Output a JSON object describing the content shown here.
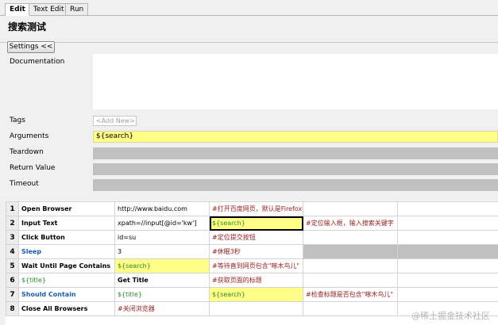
{
  "tabs": [
    "Edit",
    "Text Edit",
    "Run"
  ],
  "title": "搜索测试",
  "settings_label": "Settings <<",
  "fields": {
    "documentation": "Documentation",
    "tags": "Tags",
    "add_new": "<Add New>",
    "arguments": "Arguments",
    "arguments_value": "${search}",
    "teardown": "Teardown",
    "return_value": "Return Value",
    "timeout": "Timeout"
  },
  "rows": [
    {
      "num": "1",
      "c1": "Open Browser",
      "c2": "http://www.baidu.com",
      "c3": "#打开百度网页，默认是Firefox浏",
      "c4": "",
      "c5": ""
    },
    {
      "num": "2",
      "c1": "Input Text",
      "c2": "xpath=//input[@id='kw']",
      "c3": "${search}",
      "c4": "#定位输入框，输入搜索关键字",
      "c5": ""
    },
    {
      "num": "3",
      "c1": "Click Button",
      "c2": "id=su",
      "c3": "#定位提交按钮",
      "c4": "",
      "c5": ""
    },
    {
      "num": "4",
      "c1": "Sleep",
      "c2": "3",
      "c3": "#休眠3秒",
      "c4": "",
      "c5": ""
    },
    {
      "num": "5",
      "c1": "Wait Until Page Contains",
      "c2": "${search}",
      "c3": "#等待直到网页包含\"啄木鸟儿\"",
      "c4": "",
      "c5": ""
    },
    {
      "num": "6",
      "c1": "${title}",
      "c2": "Get Title",
      "c3": "#获取页面的标题",
      "c4": "",
      "c5": ""
    },
    {
      "num": "7",
      "c1": "Should Contain",
      "c2": "${title}",
      "c3": "${search}",
      "c4": "#检查标题是否包含\"啄木鸟儿\"",
      "c5": ""
    },
    {
      "num": "8",
      "c1": "Close All Browsers",
      "c2": "#关闭浏览器",
      "c3": "",
      "c4": "",
      "c5": ""
    }
  ],
  "watermark": "@稀土掘金技术社区"
}
